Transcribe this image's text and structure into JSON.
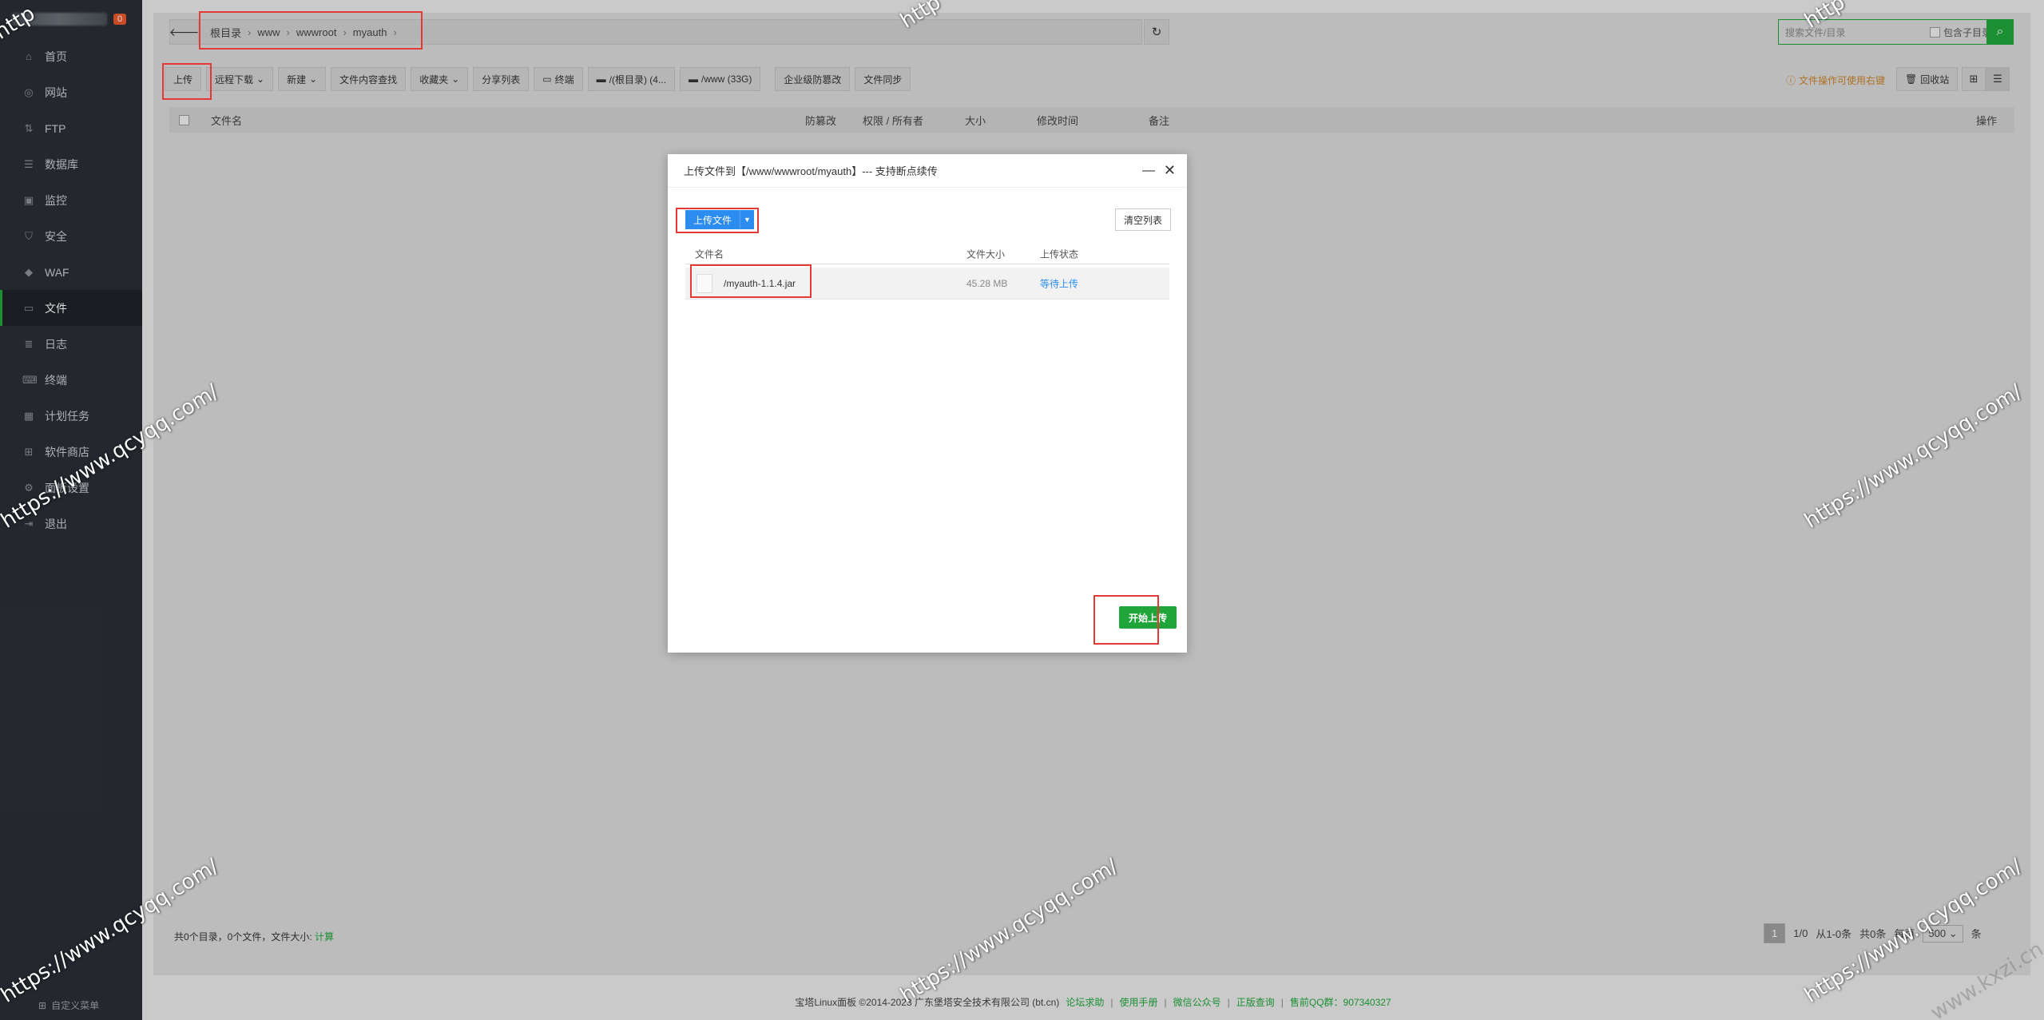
{
  "sidebar": {
    "badge": "0",
    "items": [
      {
        "label": "首页",
        "icon": "home-icon",
        "glyph": "⌂"
      },
      {
        "label": "网站",
        "icon": "globe-icon",
        "glyph": "◎"
      },
      {
        "label": "FTP",
        "icon": "ftp-icon",
        "glyph": "⇅"
      },
      {
        "label": "数据库",
        "icon": "database-icon",
        "glyph": "☰"
      },
      {
        "label": "监控",
        "icon": "monitor-icon",
        "glyph": "▣"
      },
      {
        "label": "安全",
        "icon": "shield-icon",
        "glyph": "⛉"
      },
      {
        "label": "WAF",
        "icon": "waf-shield-icon",
        "glyph": "◆"
      },
      {
        "label": "文件",
        "icon": "folder-icon",
        "glyph": "▭"
      },
      {
        "label": "日志",
        "icon": "log-icon",
        "glyph": "≣"
      },
      {
        "label": "终端",
        "icon": "terminal-icon",
        "glyph": "⌨"
      },
      {
        "label": "计划任务",
        "icon": "calendar-icon",
        "glyph": "▦"
      },
      {
        "label": "软件商店",
        "icon": "apps-icon",
        "glyph": "⊞"
      },
      {
        "label": "面板设置",
        "icon": "settings-icon",
        "glyph": "⚙"
      },
      {
        "label": "退出",
        "icon": "logout-icon",
        "glyph": "⇥"
      }
    ],
    "footer": "自定义菜单"
  },
  "path": {
    "crumbs": [
      "根目录",
      "www",
      "wwwroot",
      "myauth"
    ]
  },
  "search": {
    "placeholder": "搜索文件/目录",
    "subdir_label": "包含子目录"
  },
  "toolbar": {
    "upload": "上传",
    "remote_download": "远程下载",
    "new": "新建",
    "content_search": "文件内容查找",
    "favorites": "收藏夹",
    "share_list": "分享列表",
    "terminal": "终端",
    "disk_root": "/(根目录) (4...",
    "disk_www": "/www (33G)",
    "tamper": "企业级防篡改",
    "sync": "文件同步",
    "tip": "文件操作可使用右键",
    "recycle": "回收站"
  },
  "table": {
    "headers": {
      "name": "文件名",
      "tamper": "防篡改",
      "perm": "权限 / 所有者",
      "size": "大小",
      "mtime": "修改时间",
      "note": "备注",
      "ops": "操作"
    }
  },
  "footer": {
    "summary": "共0个目录，0个文件，文件大小:",
    "calc": "计算",
    "page_current": "1",
    "page_total": "1/0",
    "range": "从1-0条",
    "total": "共0条",
    "per_page_label": "每页",
    "per_page": "500",
    "unit": "条"
  },
  "copyright": {
    "text": "宝塔Linux面板 ©2014-2023 广东堡塔安全技术有限公司 (bt.cn)",
    "links": [
      "论坛求助",
      "使用手册",
      "微信公众号",
      "正版查询",
      "售前QQ群：907340327"
    ]
  },
  "dialog": {
    "title": "上传文件到【/www/wwwroot/myauth】--- 支持断点续传",
    "upload_button": "上传文件",
    "clear_button": "清空列表",
    "headers": {
      "name": "文件名",
      "size": "文件大小",
      "status": "上传状态"
    },
    "file": {
      "name": "/myauth-1.1.4.jar",
      "size": "45.28 MB",
      "status": "等待上传"
    },
    "start_button": "开始上传"
  },
  "watermark": {
    "text": "https://www.qcyqq.com/",
    "partial": "http",
    "corner": "www.kxzi.cn"
  },
  "colors": {
    "accent_green": "#20a53a",
    "primary_blue": "#2d8cf0",
    "sidebar_bg": "#2a2f35",
    "annotation_red": "#e53935"
  }
}
